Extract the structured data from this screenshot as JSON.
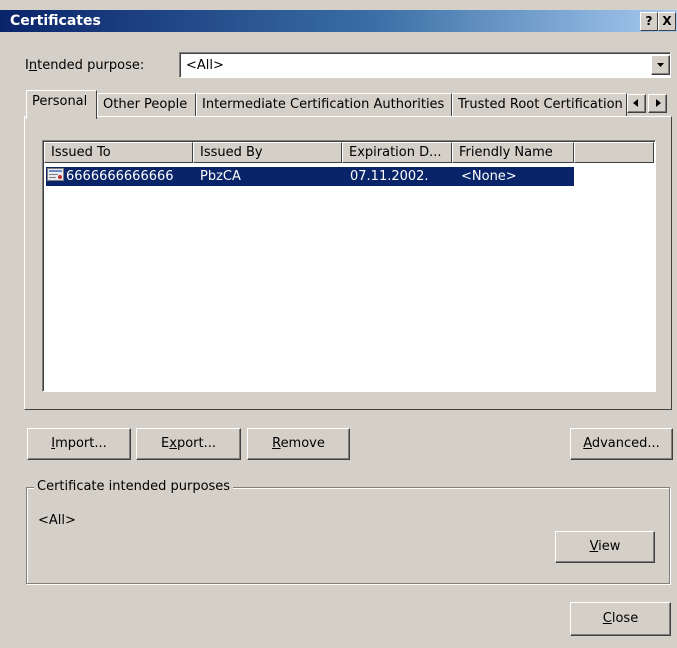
{
  "window": {
    "title": "Certificates",
    "help_label": "?",
    "close_label": "X"
  },
  "purpose": {
    "label_pre": "I",
    "label_key": "n",
    "label_post": "tended purpose:",
    "value": "<All>"
  },
  "tabs": [
    {
      "label": "Personal",
      "active": true
    },
    {
      "label": "Other People",
      "active": false
    },
    {
      "label": "Intermediate Certification Authorities",
      "active": false
    },
    {
      "label": "Trusted Root Certification",
      "active": false
    }
  ],
  "list": {
    "columns": [
      "Issued To",
      "Issued By",
      "Expiration D...",
      "Friendly Name"
    ],
    "rows": [
      {
        "issued_to": "6666666666666",
        "issued_by": "PbzCA",
        "expiration": "07.11.2002.",
        "friendly_name": "<None>",
        "selected": true
      }
    ]
  },
  "buttons": {
    "import_key": "I",
    "import_rest": "mport...",
    "export_pre": "E",
    "export_key": "x",
    "export_rest": "port...",
    "remove_key": "R",
    "remove_rest": "emove",
    "advanced_key": "A",
    "advanced_rest": "dvanced...",
    "view_key": "V",
    "view_rest": "iew",
    "close_key": "C",
    "close_rest": "lose"
  },
  "group": {
    "title": "Certificate intended purposes",
    "value": "<All>"
  },
  "colors": {
    "title_bar": "#0a246a",
    "selection": "#0a246a",
    "face": "#d4d0c8"
  }
}
